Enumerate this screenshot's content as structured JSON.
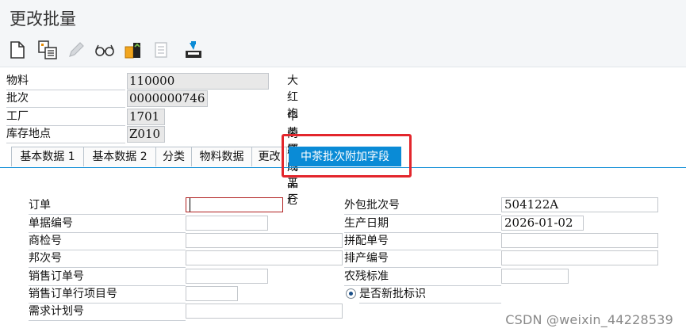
{
  "window": {
    "title": "更改批量"
  },
  "toolbar": {
    "icons": [
      "new-document-icon",
      "display-change-icon",
      "pencil-icon",
      "glasses-icon",
      "transport-icon",
      "print-icon",
      "save-icon"
    ]
  },
  "header": {
    "material": {
      "label": "物料",
      "value": "110000",
      "desc": "大红袍"
    },
    "batch": {
      "label": "批次",
      "value": "0000000746"
    },
    "plant": {
      "label": "工厂",
      "value": "1701",
      "desc": "中茶厦门工厂"
    },
    "storage": {
      "label": "库存地点",
      "value": "Z010",
      "desc": "内销成品仓"
    }
  },
  "tabs": [
    {
      "label": "基本数据 1"
    },
    {
      "label": "基本数据 2"
    },
    {
      "label": "分类"
    },
    {
      "label": "物料数据"
    },
    {
      "label": "更改"
    },
    {
      "label": "中茶批次附加字段",
      "active": true
    }
  ],
  "form": {
    "left": [
      {
        "label": "订单",
        "value": ""
      },
      {
        "label": "单据编号",
        "value": ""
      },
      {
        "label": "商检号",
        "value": ""
      },
      {
        "label": "邦次号",
        "value": ""
      },
      {
        "label": "销售订单号",
        "value": ""
      },
      {
        "label": "销售订单行项目号",
        "value": ""
      },
      {
        "label": "需求计划号",
        "value": ""
      }
    ],
    "right": [
      {
        "label": "外包批次号",
        "value": "504122A"
      },
      {
        "label": "生产日期",
        "value": "2026-01-02"
      },
      {
        "label": "拼配单号",
        "value": ""
      },
      {
        "label": "排产编号",
        "value": ""
      },
      {
        "label": "农残标准",
        "value": ""
      }
    ],
    "new_batch_flag": {
      "label": "是否新批标识",
      "selected": true
    }
  },
  "colors": {
    "accent": "#0a8bd6",
    "highlight": "#e3262c"
  },
  "watermark": "CSDN @weixin_44228539"
}
